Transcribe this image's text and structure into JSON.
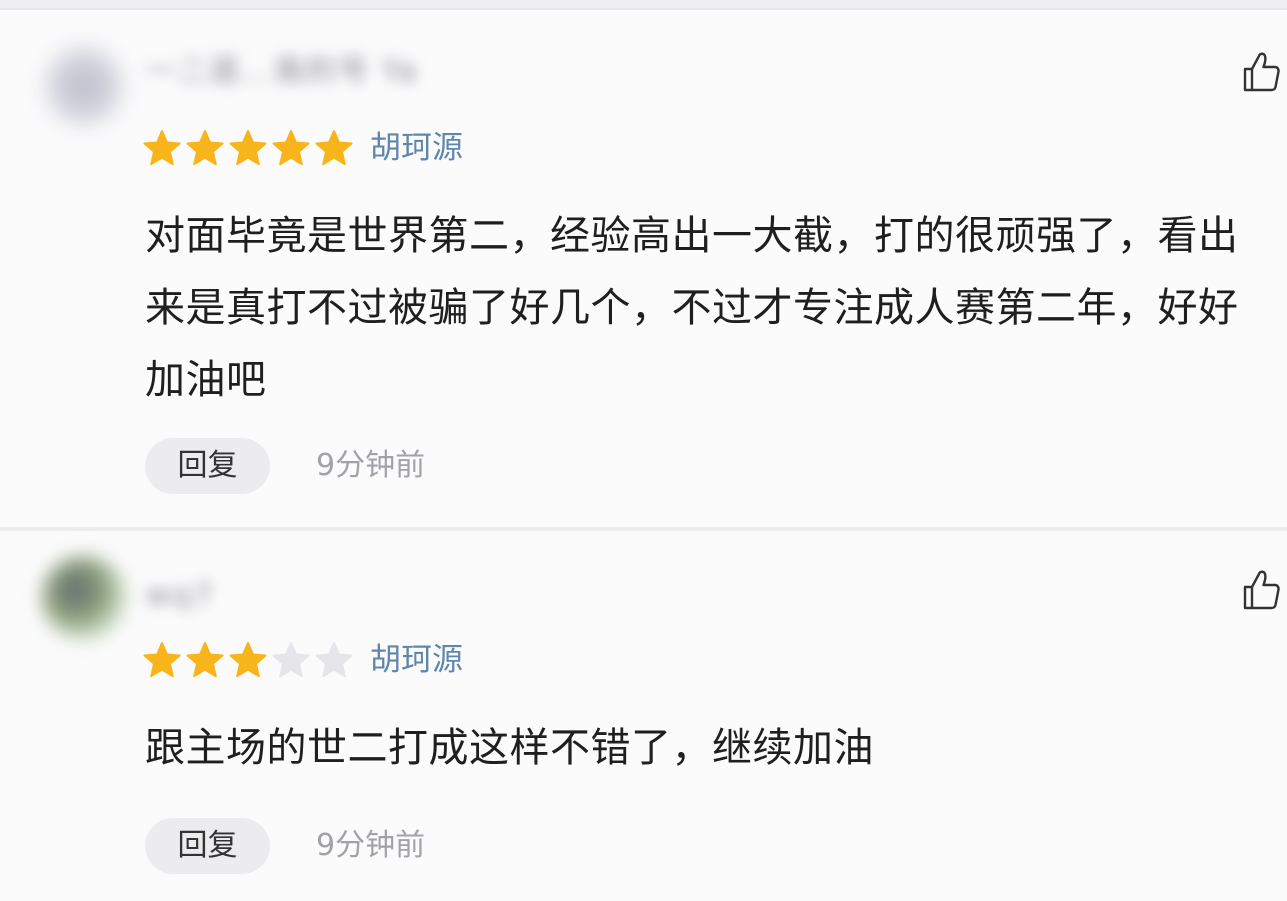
{
  "comments": [
    {
      "username": "一二逛…我的号 Ya",
      "rating": 5,
      "max_rating": 5,
      "tag": "胡珂源",
      "text": "对面毕竟是世界第二，经验高出一大截，打的很顽强了，看出来是真打不过被骗了好几个，不过才专注成人赛第二年，好好加油吧",
      "reply_label": "回复",
      "time": "9分钟前",
      "like_icon": "thumbs-up-icon"
    },
    {
      "username": "wq7",
      "rating": 3,
      "max_rating": 5,
      "tag": "胡珂源",
      "text": "跟主场的世二打成这样不错了，继续加油",
      "reply_label": "回复",
      "time": "9分钟前",
      "like_icon": "thumbs-up-icon"
    }
  ],
  "colors": {
    "star_filled": "#f7b41b",
    "star_empty": "#e6e6ea",
    "tag": "#5f86ad",
    "time": "#a2a2a8",
    "reply_bg": "#ececee"
  }
}
